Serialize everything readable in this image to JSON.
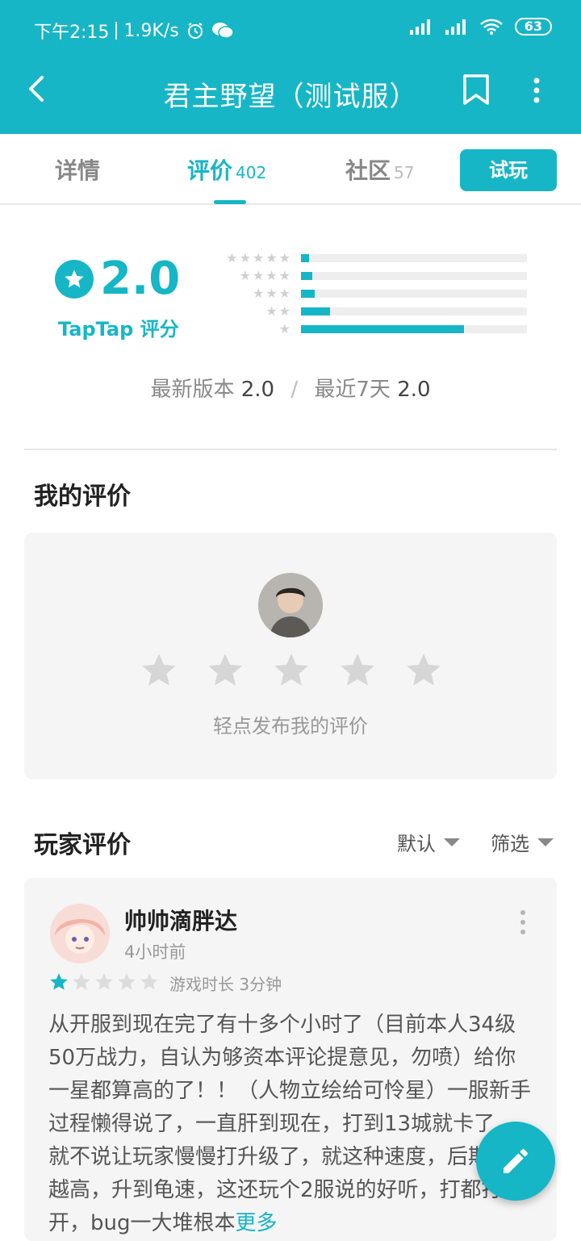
{
  "status_bar": {
    "time": "下午2:15",
    "speed": "1.9K/s",
    "battery": "63"
  },
  "app_bar": {
    "title": "君主野望（测试服）"
  },
  "tabs": [
    {
      "label": "详情",
      "count": ""
    },
    {
      "label": "评价",
      "count": "402"
    },
    {
      "label": "社区",
      "count": "57"
    }
  ],
  "try_button": "试玩",
  "rating": {
    "score": "2.0",
    "source": "TapTap 评分",
    "distribution": [
      {
        "stars": "★★★★★",
        "fraction": 0.035
      },
      {
        "stars": "★★★★",
        "fraction": 0.05
      },
      {
        "stars": "★★★",
        "fraction": 0.06
      },
      {
        "stars": "★★",
        "fraction": 0.13
      },
      {
        "stars": "★",
        "fraction": 0.72
      }
    ],
    "latest_label": "最新版本",
    "latest_value": "2.0",
    "separator": "/",
    "recent_label": "最近7天",
    "recent_value": "2.0"
  },
  "my_review": {
    "title": "我的评价",
    "hint": "轻点发布我的评价"
  },
  "player_reviews": {
    "title": "玩家评价",
    "sort_label": "默认",
    "filter_label": "筛选"
  },
  "review": {
    "author": "帅帅滴胖达",
    "time": "4小时前",
    "rating": 1,
    "playtime": "游戏时长 3分钟",
    "text": "从开服到现在完了有十多个小时了（目前本人34级50万战力，自认为够资本评论提意见，勿喷）给你一星都算高的了！！（人物立绘给可怜星）一服新手过程懒得说了，一直肝到现在，打到13城就卡了，就不说让玩家慢慢打升级了，就这种速度，后期难度越高，升到龟速，这还玩个2服说的好听，打都打不开，bug一大堆根本",
    "more": "更多"
  },
  "colors": {
    "accent": "#16b6c6",
    "star_inactive": "#d6d6d6"
  }
}
